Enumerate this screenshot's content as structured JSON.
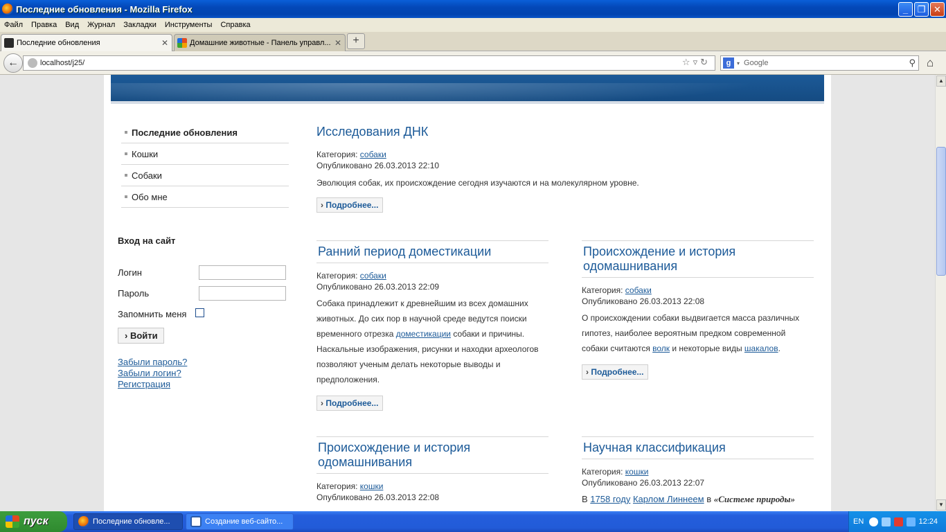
{
  "window": {
    "title": "Последние обновления - Mozilla Firefox"
  },
  "menu": [
    "Файл",
    "Правка",
    "Вид",
    "Журнал",
    "Закладки",
    "Инструменты",
    "Справка"
  ],
  "tabs": [
    {
      "label": "Последние обновления",
      "active": true
    },
    {
      "label": "Домашние животные - Панель управл...",
      "active": false
    }
  ],
  "nav": {
    "url": "localhost/j25/",
    "search_placeholder": "Google"
  },
  "sidebar": {
    "menu": [
      "Последние обновления",
      "Кошки",
      "Собаки",
      "Обо мне"
    ],
    "login": {
      "title": "Вход на сайт",
      "username_label": "Логин",
      "password_label": "Пароль",
      "remember_label": "Запомнить меня",
      "submit": "Войти",
      "forgot_password": "Забыли пароль?",
      "forgot_login": "Забыли логин?",
      "register": "Регистрация"
    }
  },
  "articles": {
    "a1": {
      "title": "Исследования ДНК",
      "category_label": "Категория: ",
      "category": "собаки",
      "published": "Опубликовано 26.03.2013 22:10",
      "text": "Эволюция собак, их происхождение сегодня изучаются и на молекулярном уровне.",
      "more": "Подробнее..."
    },
    "a2": {
      "title": "Ранний период доместикации",
      "category_label": "Категория: ",
      "category": "собаки",
      "published": "Опубликовано 26.03.2013 22:09",
      "text_1": "Собака принадлежит к древнейшим из всех домашних животных. До сих пор в научной среде ведутся поиски временного отрезка ",
      "link": "доместикации",
      "text_2": " собаки и причины. Наскальные изображения, рисунки и находки археологов позволяют ученым делать некоторые выводы и предположения.",
      "more": "Подробнее..."
    },
    "a3": {
      "title": "Происхождение и история одомашнивания",
      "category_label": "Категория: ",
      "category": "собаки",
      "published": "Опубликовано 26.03.2013 22:08",
      "text_1": "О происхождении собаки выдвигается масса различных гипотез, наиболее вероятным предком современной собаки считаются ",
      "link_1": "волк",
      "text_2": " и некоторые виды ",
      "link_2": "шакалов",
      "text_3": ".",
      "more": "Подробнее..."
    },
    "a4": {
      "title": "Происхождение и история одомашнивания",
      "category_label": "Категория: ",
      "category": "кошки",
      "published": "Опубликовано 26.03.2013 22:08"
    },
    "a5": {
      "title": "Научная классификация",
      "category_label": "Категория: ",
      "category": "кошки",
      "published": "Опубликовано 26.03.2013 22:07",
      "text_1": "В ",
      "link_1": "1758 году",
      "text_2": " ",
      "link_2": "Карлом Линнеем",
      "text_3": " в ",
      "bold": "«Системе природы»"
    }
  },
  "taskbar": {
    "start": "пуск",
    "items": [
      "Последние обновле...",
      "Создание веб-сайто..."
    ],
    "lang": "EN",
    "clock": "12:24"
  },
  "colors": {
    "link": "#1c5a98",
    "banner": "#1c5a98",
    "taskbar": "#245edc",
    "start": "#3d9d3d"
  }
}
